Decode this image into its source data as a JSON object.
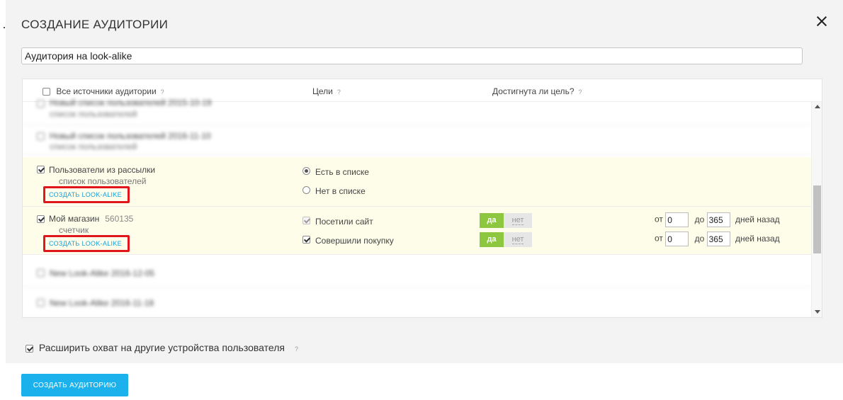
{
  "modal": {
    "title": "СОЗДАНИЕ АУДИТОРИИ",
    "name_value": "Аудитория на look-alike"
  },
  "table": {
    "headers": {
      "sources": "Все источники аудитории",
      "goals": "Цели",
      "achieved": "Достигнута ли цель?",
      "help": "?"
    },
    "rows": [
      {
        "name": "Новый список пользователей 2015-10-19",
        "type": "список пользователей",
        "blurred": true
      },
      {
        "name": "Новый список пользователей 2016-11-10",
        "type": "список пользователей",
        "blurred": true
      },
      {
        "name": "Пользователи из рассылки",
        "type": "список пользователей",
        "look_alike": "СОЗДАТЬ LOOK-ALIKE",
        "options": [
          {
            "label": "Есть в списке",
            "selected": true
          },
          {
            "label": "Нет в списке",
            "selected": false
          }
        ]
      },
      {
        "name": "Мой магазин",
        "counter_id": "560135",
        "type": "счетчик",
        "look_alike": "СОЗДАТЬ LOOK-ALIKE",
        "goals": [
          {
            "label": "Посетили сайт",
            "yes": "да",
            "no": "нет",
            "from_label": "от",
            "from": "0",
            "to_label": "до",
            "to": "365",
            "suffix": "дней назад"
          },
          {
            "label": "Совершили покупку",
            "yes": "да",
            "no": "нет",
            "from_label": "от",
            "from": "0",
            "to_label": "до",
            "to": "365",
            "suffix": "дней назад"
          }
        ]
      },
      {
        "name": "New Look-Alike 2016-12-05",
        "blurred": true
      },
      {
        "name": "New Look-Alike 2016-11-18",
        "blurred": true
      }
    ]
  },
  "expand": {
    "label": "Расширить охват на другие устройства пользователя",
    "help": "?"
  },
  "footer": {
    "create_label": "СОЗДАТЬ АУДИТОРИЮ"
  },
  "colors": {
    "accent": "#1ab1ec",
    "toggle_yes": "#8dc63f",
    "highlight_box": "#e2141c",
    "selected_row": "#fdfde9"
  }
}
